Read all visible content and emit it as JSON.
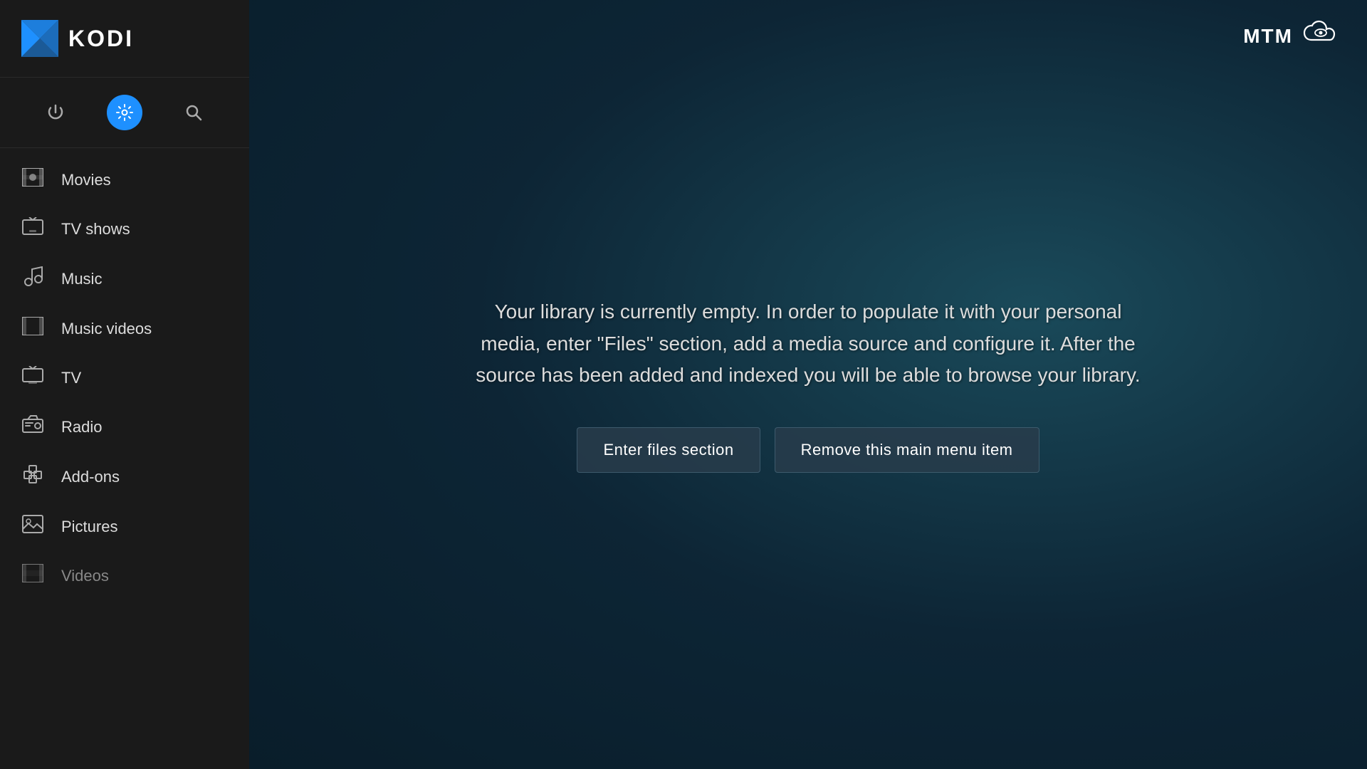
{
  "app": {
    "name": "KODI",
    "brand": "MTM"
  },
  "controls": [
    {
      "id": "power",
      "label": "Power",
      "icon": "⏻",
      "active": false
    },
    {
      "id": "settings",
      "label": "Settings",
      "icon": "⚙",
      "active": true
    },
    {
      "id": "search",
      "label": "Search",
      "icon": "🔍",
      "active": false
    }
  ],
  "nav": {
    "items": [
      {
        "id": "movies",
        "label": "Movies",
        "icon": "movies"
      },
      {
        "id": "tv-shows",
        "label": "TV shows",
        "icon": "tvshows"
      },
      {
        "id": "music",
        "label": "Music",
        "icon": "music"
      },
      {
        "id": "music-videos",
        "label": "Music videos",
        "icon": "musicvideos"
      },
      {
        "id": "tv",
        "label": "TV",
        "icon": "tv"
      },
      {
        "id": "radio",
        "label": "Radio",
        "icon": "radio"
      },
      {
        "id": "add-ons",
        "label": "Add-ons",
        "icon": "addons"
      },
      {
        "id": "pictures",
        "label": "Pictures",
        "icon": "pictures"
      },
      {
        "id": "videos",
        "label": "Videos",
        "icon": "videos",
        "dimmed": true
      }
    ]
  },
  "main": {
    "empty_message": "Your library is currently empty. In order to populate it with your personal media, enter \"Files\" section, add a media source and configure it. After the source has been added and indexed you will be able to browse your library.",
    "btn_enter_files": "Enter files section",
    "btn_remove_menu": "Remove this main menu item"
  }
}
